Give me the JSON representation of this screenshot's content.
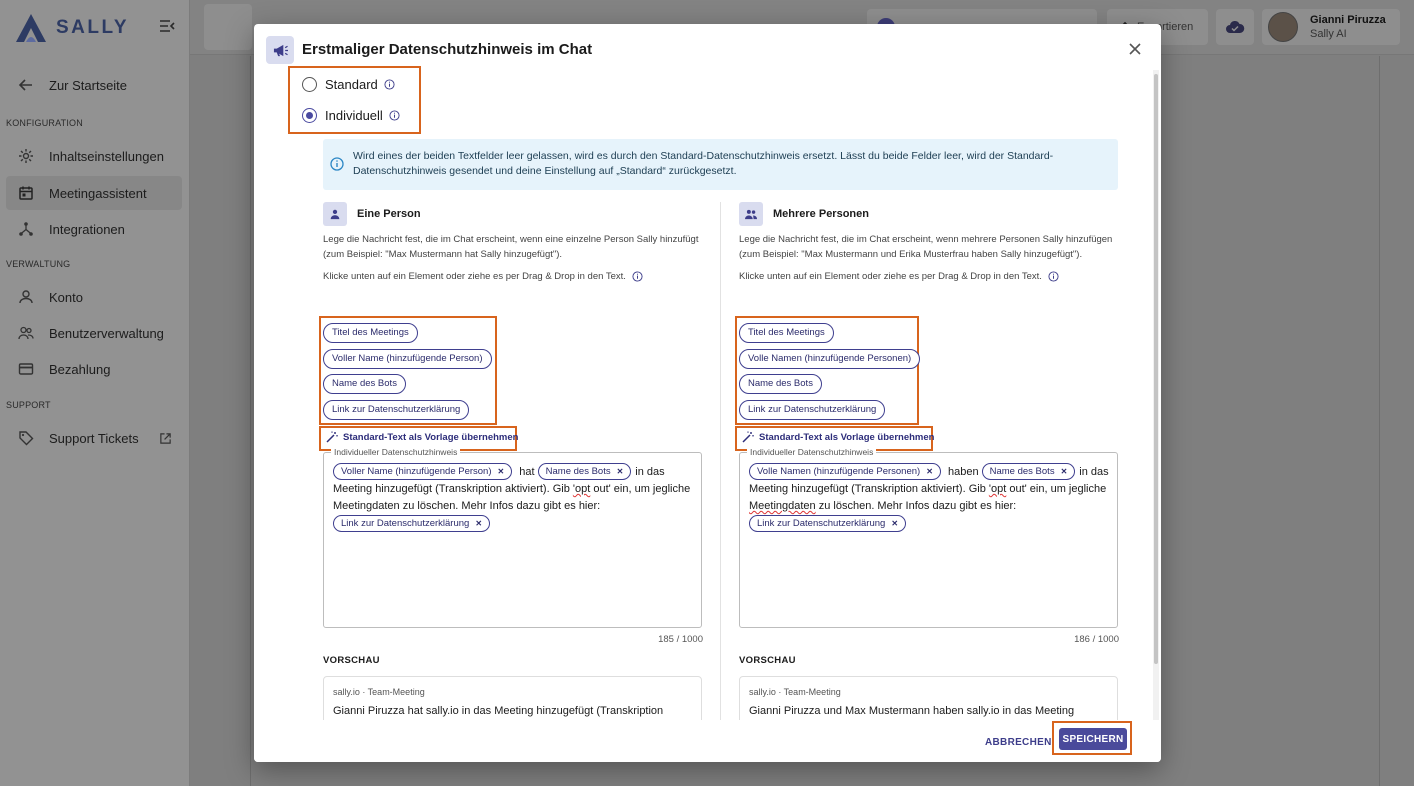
{
  "app": {
    "brand": "SALLY",
    "colors": {
      "primary": "#4a4a9b",
      "highlight": "#d8641d",
      "info_bg": "#e6f3fb"
    }
  },
  "sidebar": {
    "back": "Zur Startseite",
    "sections": [
      {
        "label": "KONFIGURATION",
        "items": [
          "Inhaltseinstellungen",
          "Meetingassistent",
          "Integrationen"
        ]
      },
      {
        "label": "VERWALTUNG",
        "items": [
          "Konto",
          "Benutzerverwaltung",
          "Bezahlung"
        ]
      },
      {
        "label": "SUPPORT",
        "items": [
          "Support Tickets"
        ]
      }
    ],
    "active_item": "Meetingassistent"
  },
  "topbar": {
    "export_label": "Exportieren",
    "user_name": "Gianni Piruzza",
    "user_org": "Sally AI"
  },
  "dialog": {
    "title": "Erstmaliger Datenschutzhinweis im Chat",
    "options": [
      {
        "label": "Standard",
        "selected": false
      },
      {
        "label": "Individuell",
        "selected": true
      }
    ],
    "info_text": "Wird eines der beiden Textfelder leer gelassen, wird es durch den Standard-Datenschutzhinweis ersetzt. Lässt du beide Felder leer, wird der Standard-Datenschutzhinweis gesendet und deine Einstellung auf „Standard“ zurückgesetzt.",
    "columns": [
      {
        "title": "Eine Person",
        "description": "Lege die Nachricht fest, die im Chat erscheint, wenn eine einzelne Person Sally hinzufügt (zum Beispiel: \"Max Mustermann hat Sally hinzugefügt\").",
        "hint": "Klicke unten auf ein Element oder ziehe es per Drag & Drop in den Text.",
        "chips": [
          "Titel des Meetings",
          "Voller Name (hinzufügende Person)",
          "Name des Bots",
          "Link zur Datenschutzerklärung"
        ],
        "template_link": "Standard-Text als Vorlage übernehmen",
        "field_label": "Individueller Datenschutzhinweis",
        "field": {
          "chip1": "Voller Name (hinzufügende Person)",
          "t1": "hat",
          "chip2": "Name des Bots",
          "t2": "in das Meeting hinzugefügt (Transkription aktiviert). Gib ",
          "t3": "'opt",
          "t4": " out' ein, um jegliche Meetingdaten zu löschen. Mehr Infos dazu gibt es hier:",
          "chip3": "Link zur Datenschutzerklärung"
        },
        "counter": "185 / 1000",
        "preview_label": "VORSCHAU",
        "preview_meta": "sally.io · Team-Meeting",
        "preview_text": "Gianni Piruzza hat sally.io in das Meeting hinzugefügt (Transkription aktiviert). Gib 'opt out' ein, um jegliche Meetingdaten zu löschen. Mehr Infos dazu gibt es hier: https://sally.io/privacy"
      },
      {
        "title": "Mehrere Personen",
        "description": "Lege die Nachricht fest, die im Chat erscheint, wenn mehrere Personen Sally hinzufügen (zum Beispiel: \"Max Mustermann und Erika Musterfrau haben Sally hinzugefügt\").",
        "hint": "Klicke unten auf ein Element oder ziehe es per Drag & Drop in den Text.",
        "chips": [
          "Titel des Meetings",
          "Volle Namen (hinzufügende Personen)",
          "Name des Bots",
          "Link zur Datenschutzerklärung"
        ],
        "template_link": "Standard-Text als Vorlage übernehmen",
        "field_label": "Individueller Datenschutzhinweis",
        "field": {
          "chip1": "Volle Namen (hinzufügende Personen)",
          "t1": "haben",
          "chip2": "Name des Bots",
          "t2": "in das Meeting hinzugefügt (Transkription aktiviert). Gib ",
          "t3": "'opt",
          "t4": " out' ein, um jegliche ",
          "t5": "Meetingdaten",
          "t6": " zu löschen. Mehr Infos dazu gibt es hier:",
          "chip3": "Link zur Datenschutzerklärung"
        },
        "counter": "186 / 1000",
        "preview_label": "VORSCHAU",
        "preview_meta": "sally.io · Team-Meeting",
        "preview_text": "Gianni Piruzza und Max Mustermann haben sally.io in das Meeting hinzugefügt (Transkription aktiviert). Gib 'opt out' ein, um jegliche Meetingdaten zu löschen. Mehr Infos dazu gibt es hier:"
      }
    ],
    "cancel_label": "ABBRECHEN",
    "save_label": "SPEICHERN"
  }
}
